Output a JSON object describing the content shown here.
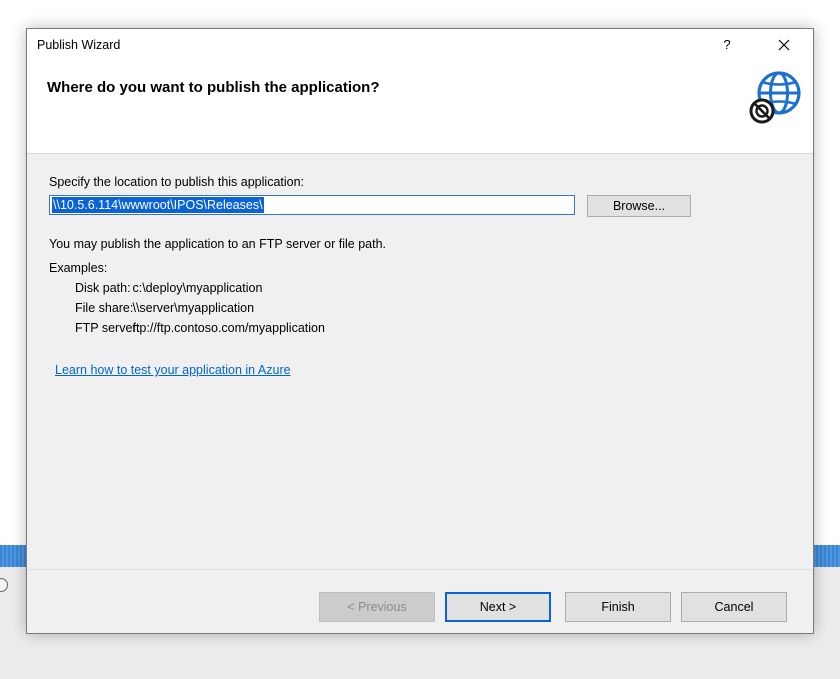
{
  "window": {
    "title": "Publish Wizard",
    "help_label": "?",
    "close_label": "✕"
  },
  "header": {
    "heading": "Where do you want to publish the application?",
    "icon": "globe-publish-icon"
  },
  "location": {
    "label": "Specify the location to publish this application:",
    "path_value": "\\\\10.5.6.114\\wwwroot\\IPOS\\Releases\\",
    "browse_label": "Browse..."
  },
  "info": {
    "hint": "You may publish the application to an FTP server or file path.",
    "examples_label": "Examples:",
    "examples": [
      {
        "key": "Disk path:",
        "value": "c:\\deploy\\myapplication"
      },
      {
        "key": "File share:",
        "value": "\\\\server\\myapplication"
      },
      {
        "key": "FTP server:",
        "value": "ftp://ftp.contoso.com/myapplication"
      }
    ]
  },
  "link": {
    "azure": "Learn how to test your application in Azure"
  },
  "buttons": {
    "previous": "< Previous",
    "next": "Next >",
    "finish": "Finish",
    "cancel": "Cancel"
  },
  "colors": {
    "accent": "#0a64d8",
    "link": "#0066cc"
  }
}
